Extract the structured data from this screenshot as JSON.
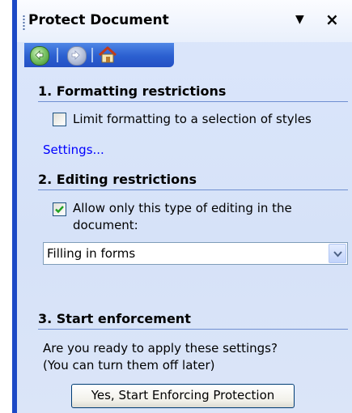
{
  "pane": {
    "title": "Protect Document",
    "menu_arrow": "▼",
    "close": "×"
  },
  "nav": {
    "back_icon": "back-arrow-icon",
    "forward_icon": "forward-arrow-icon",
    "home_icon": "home-icon"
  },
  "formatting": {
    "heading": "1. Formatting restrictions",
    "checkbox_label": "Limit formatting to a selection of styles",
    "checked": false,
    "settings_link": "Settings..."
  },
  "editing": {
    "heading": "2. Editing restrictions",
    "checkbox_label_line1": "Allow only this type of editing in the",
    "checkbox_label_line2": "document:",
    "checked": true,
    "dropdown_value": "Filling in forms"
  },
  "enforcement": {
    "heading": "3. Start enforcement",
    "question_line1": "Are you ready to apply these settings?",
    "question_line2": "(You can turn them off later)",
    "button_label": "Yes, Start Enforcing Protection"
  },
  "colors": {
    "frame_blue": "#1c49c6",
    "nav_blue": "#2b5fd0",
    "link_blue": "#0000ff",
    "pane_bg": "#d6e2f8"
  }
}
